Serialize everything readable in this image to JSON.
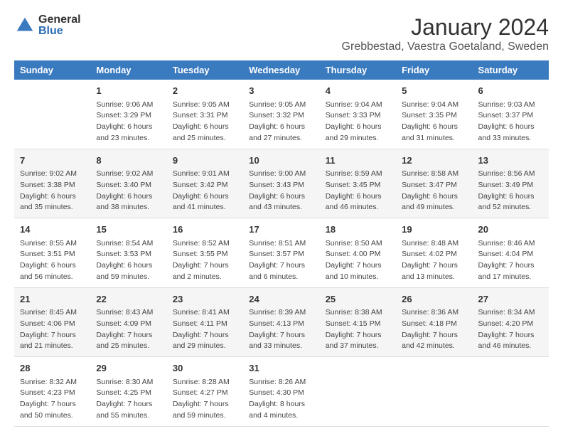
{
  "logo": {
    "general": "General",
    "blue": "Blue"
  },
  "title": "January 2024",
  "subtitle": "Grebbestad, Vaestra Goetaland, Sweden",
  "header_days": [
    "Sunday",
    "Monday",
    "Tuesday",
    "Wednesday",
    "Thursday",
    "Friday",
    "Saturday"
  ],
  "weeks": [
    [
      {
        "day": "",
        "info": ""
      },
      {
        "day": "1",
        "info": "Sunrise: 9:06 AM\nSunset: 3:29 PM\nDaylight: 6 hours\nand 23 minutes."
      },
      {
        "day": "2",
        "info": "Sunrise: 9:05 AM\nSunset: 3:31 PM\nDaylight: 6 hours\nand 25 minutes."
      },
      {
        "day": "3",
        "info": "Sunrise: 9:05 AM\nSunset: 3:32 PM\nDaylight: 6 hours\nand 27 minutes."
      },
      {
        "day": "4",
        "info": "Sunrise: 9:04 AM\nSunset: 3:33 PM\nDaylight: 6 hours\nand 29 minutes."
      },
      {
        "day": "5",
        "info": "Sunrise: 9:04 AM\nSunset: 3:35 PM\nDaylight: 6 hours\nand 31 minutes."
      },
      {
        "day": "6",
        "info": "Sunrise: 9:03 AM\nSunset: 3:37 PM\nDaylight: 6 hours\nand 33 minutes."
      }
    ],
    [
      {
        "day": "7",
        "info": "Sunrise: 9:02 AM\nSunset: 3:38 PM\nDaylight: 6 hours\nand 35 minutes."
      },
      {
        "day": "8",
        "info": "Sunrise: 9:02 AM\nSunset: 3:40 PM\nDaylight: 6 hours\nand 38 minutes."
      },
      {
        "day": "9",
        "info": "Sunrise: 9:01 AM\nSunset: 3:42 PM\nDaylight: 6 hours\nand 41 minutes."
      },
      {
        "day": "10",
        "info": "Sunrise: 9:00 AM\nSunset: 3:43 PM\nDaylight: 6 hours\nand 43 minutes."
      },
      {
        "day": "11",
        "info": "Sunrise: 8:59 AM\nSunset: 3:45 PM\nDaylight: 6 hours\nand 46 minutes."
      },
      {
        "day": "12",
        "info": "Sunrise: 8:58 AM\nSunset: 3:47 PM\nDaylight: 6 hours\nand 49 minutes."
      },
      {
        "day": "13",
        "info": "Sunrise: 8:56 AM\nSunset: 3:49 PM\nDaylight: 6 hours\nand 52 minutes."
      }
    ],
    [
      {
        "day": "14",
        "info": "Sunrise: 8:55 AM\nSunset: 3:51 PM\nDaylight: 6 hours\nand 56 minutes."
      },
      {
        "day": "15",
        "info": "Sunrise: 8:54 AM\nSunset: 3:53 PM\nDaylight: 6 hours\nand 59 minutes."
      },
      {
        "day": "16",
        "info": "Sunrise: 8:52 AM\nSunset: 3:55 PM\nDaylight: 7 hours\nand 2 minutes."
      },
      {
        "day": "17",
        "info": "Sunrise: 8:51 AM\nSunset: 3:57 PM\nDaylight: 7 hours\nand 6 minutes."
      },
      {
        "day": "18",
        "info": "Sunrise: 8:50 AM\nSunset: 4:00 PM\nDaylight: 7 hours\nand 10 minutes."
      },
      {
        "day": "19",
        "info": "Sunrise: 8:48 AM\nSunset: 4:02 PM\nDaylight: 7 hours\nand 13 minutes."
      },
      {
        "day": "20",
        "info": "Sunrise: 8:46 AM\nSunset: 4:04 PM\nDaylight: 7 hours\nand 17 minutes."
      }
    ],
    [
      {
        "day": "21",
        "info": "Sunrise: 8:45 AM\nSunset: 4:06 PM\nDaylight: 7 hours\nand 21 minutes."
      },
      {
        "day": "22",
        "info": "Sunrise: 8:43 AM\nSunset: 4:09 PM\nDaylight: 7 hours\nand 25 minutes."
      },
      {
        "day": "23",
        "info": "Sunrise: 8:41 AM\nSunset: 4:11 PM\nDaylight: 7 hours\nand 29 minutes."
      },
      {
        "day": "24",
        "info": "Sunrise: 8:39 AM\nSunset: 4:13 PM\nDaylight: 7 hours\nand 33 minutes."
      },
      {
        "day": "25",
        "info": "Sunrise: 8:38 AM\nSunset: 4:15 PM\nDaylight: 7 hours\nand 37 minutes."
      },
      {
        "day": "26",
        "info": "Sunrise: 8:36 AM\nSunset: 4:18 PM\nDaylight: 7 hours\nand 42 minutes."
      },
      {
        "day": "27",
        "info": "Sunrise: 8:34 AM\nSunset: 4:20 PM\nDaylight: 7 hours\nand 46 minutes."
      }
    ],
    [
      {
        "day": "28",
        "info": "Sunrise: 8:32 AM\nSunset: 4:23 PM\nDaylight: 7 hours\nand 50 minutes."
      },
      {
        "day": "29",
        "info": "Sunrise: 8:30 AM\nSunset: 4:25 PM\nDaylight: 7 hours\nand 55 minutes."
      },
      {
        "day": "30",
        "info": "Sunrise: 8:28 AM\nSunset: 4:27 PM\nDaylight: 7 hours\nand 59 minutes."
      },
      {
        "day": "31",
        "info": "Sunrise: 8:26 AM\nSunset: 4:30 PM\nDaylight: 8 hours\nand 4 minutes."
      },
      {
        "day": "",
        "info": ""
      },
      {
        "day": "",
        "info": ""
      },
      {
        "day": "",
        "info": ""
      }
    ]
  ]
}
